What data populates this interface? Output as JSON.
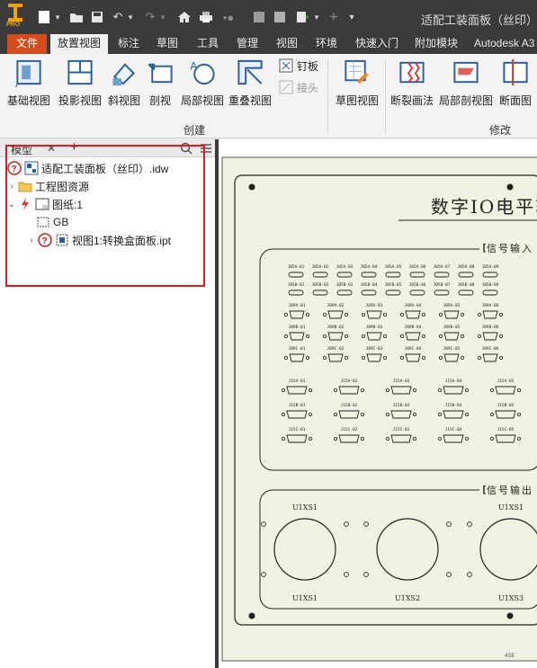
{
  "app": {
    "logo_text": "PRO",
    "document_title": "适配工装面板（丝印）.id"
  },
  "quick_access": [
    {
      "name": "new-icon",
      "glyph": "▭"
    },
    {
      "name": "open-icon",
      "glyph": "▤"
    },
    {
      "name": "save-icon",
      "glyph": "■"
    },
    {
      "name": "undo-icon",
      "glyph": "↶"
    },
    {
      "name": "redo-icon",
      "glyph": "↷"
    },
    {
      "name": "home-icon",
      "glyph": "⌂"
    },
    {
      "name": "print-icon",
      "glyph": "⎙"
    },
    {
      "name": "return-icon",
      "glyph": "•"
    },
    {
      "name": "plus-icon",
      "glyph": "+"
    }
  ],
  "menu": {
    "tabs": [
      "文件",
      "放置视图",
      "标注",
      "草图",
      "工具",
      "管理",
      "视图",
      "环境",
      "快速入门",
      "附加模块",
      "Autodesk A3"
    ],
    "active": "放置视图"
  },
  "ribbon": {
    "create_buttons": [
      "基础视图",
      "投影视图",
      "斜视图",
      "剖视",
      "局部视图",
      "重叠视图"
    ],
    "small_buttons": {
      "nail": "钉板",
      "joint": "接头"
    },
    "sketch_button": "草图视图",
    "modify_buttons": [
      "断裂画法",
      "局部剖视图",
      "断面图"
    ],
    "panel_create": "创建",
    "panel_modify": "修改"
  },
  "browser": {
    "tab_label": "模型",
    "close_glyph": "✕",
    "add_glyph": "+",
    "tree": [
      {
        "label": "适配工装面板（丝印）.idw",
        "level": 0
      },
      {
        "label": "工程图资源",
        "level": 1
      },
      {
        "label": "图纸:1",
        "level": 1
      },
      {
        "label": "GB",
        "level": 2
      },
      {
        "label": "视图1:转换盒面板.ipt",
        "level": 2
      }
    ]
  },
  "drawing": {
    "title": "数字IO电平转",
    "section_input": "信号输入",
    "section_output": "信号输出",
    "input_labels_row1": [
      "J05A-01",
      "J05A-02",
      "J05A-03",
      "J05A-04",
      "J05A-05",
      "J05A-06",
      "J05A-07",
      "J05A-08",
      "J05A-09"
    ],
    "input_labels_row2": [
      "J05B-01",
      "J05B-02",
      "J05B-03",
      "J05B-04",
      "J05B-05",
      "J05B-06",
      "J05B-07",
      "J05B-08",
      "J05B-09"
    ],
    "dsub_labels_a": [
      "J09A-01",
      "J09A-02",
      "J09A-03",
      "J09A-04",
      "J09A-05",
      "J09A-06"
    ],
    "dsub_labels_b": [
      "J09B-01",
      "J09B-02",
      "J09B-03",
      "J09B-04",
      "J09B-05",
      "J09B-06"
    ],
    "dsub_labels_c": [
      "J09C-01",
      "J09C-02",
      "J09C-03",
      "J09C-04",
      "J09C-05",
      "J09C-06"
    ],
    "dsub15_labels_a": [
      "J15A-01",
      "J15A-02",
      "J15A-03",
      "J15A-04",
      "J15A-05"
    ],
    "dsub15_labels_b": [
      "J15B-01",
      "J15B-02",
      "J15B-03",
      "J15B-04",
      "J15B-05"
    ],
    "dsub15_labels_c": [
      "J15C-01",
      "J15C-02",
      "J15C-03",
      "J15C-04",
      "J15C-05"
    ],
    "output_top_labels": [
      "U1XS1",
      "U1XS1"
    ],
    "output_bottom_labels": [
      "U1XS1",
      "U1XS2",
      "U1XS3"
    ],
    "footer_mark": "4SE"
  },
  "colors": {
    "titlebar": "#3b3b3b",
    "file_tab": "#d44b1c",
    "sheet_bg": "#f2f2e2",
    "highlight": "#e01b1b"
  }
}
